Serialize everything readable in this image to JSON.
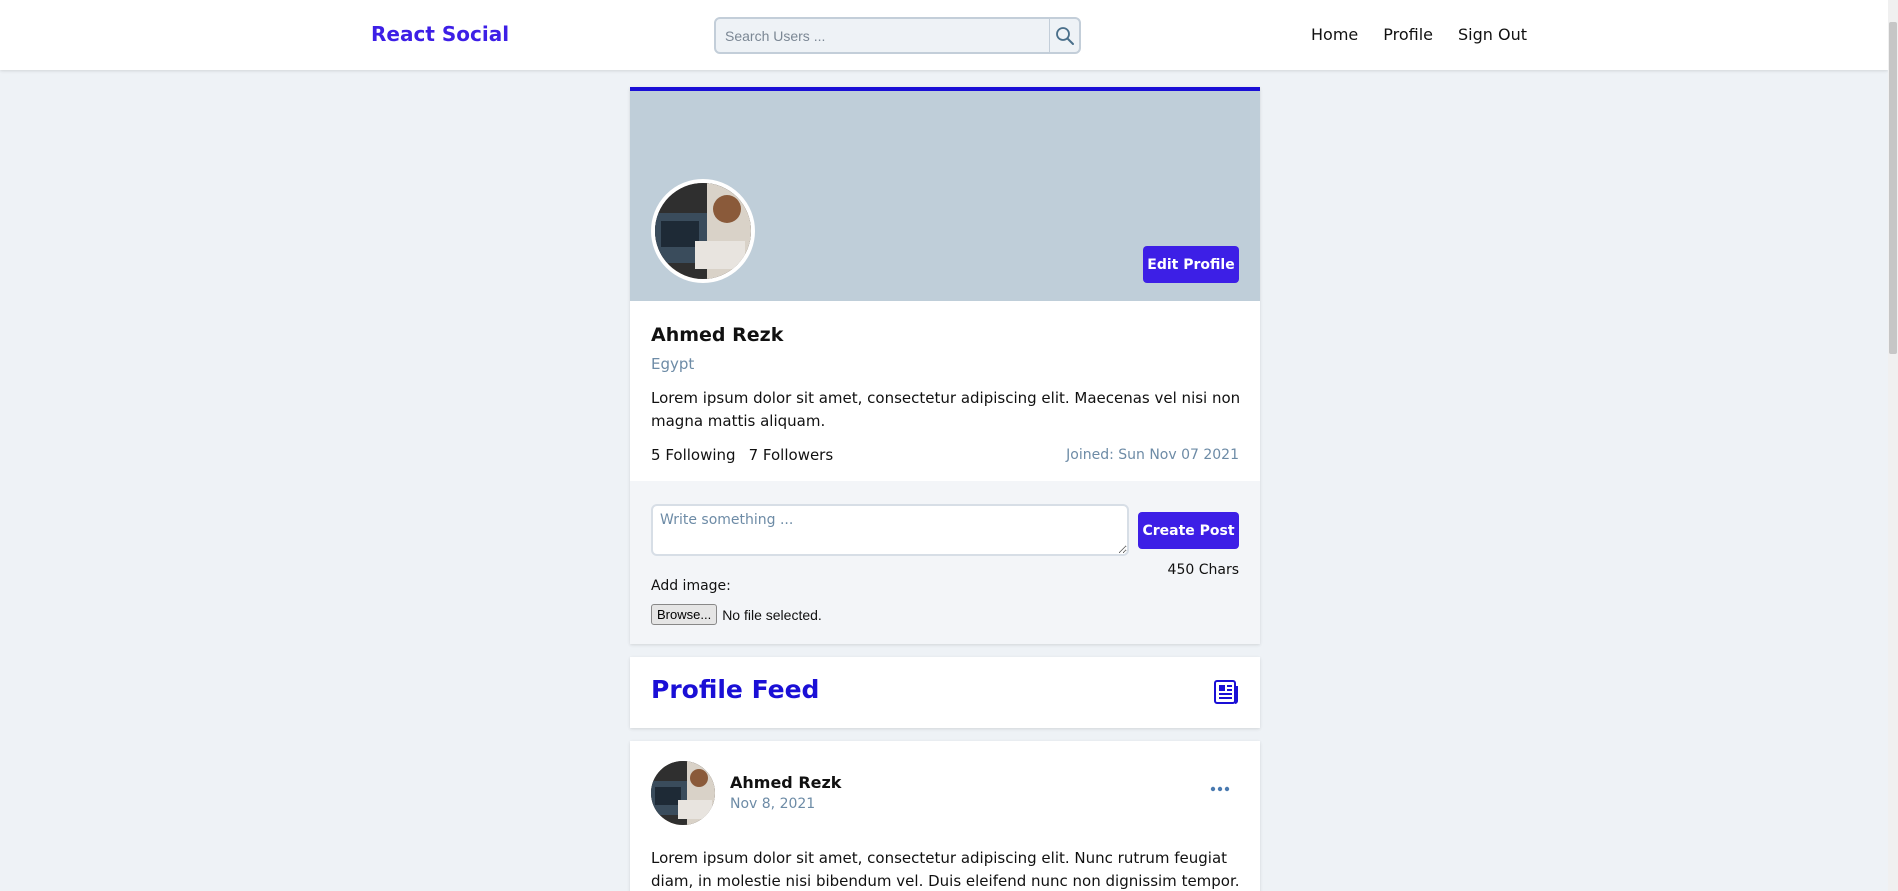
{
  "navbar": {
    "brand": "React Social",
    "search_placeholder": "Search Users ...",
    "links": [
      "Home",
      "Profile",
      "Sign Out"
    ]
  },
  "profile": {
    "name": "Ahmed Rezk",
    "location": "Egypt",
    "bio": "Lorem ipsum dolor sit amet, consectetur adipiscing elit. Maecenas vel nisi non magna mattis aliquam.",
    "following_count": "5",
    "following_label": "Following",
    "followers_count": "7",
    "followers_label": "Followers",
    "joined": "Joined: Sun Nov 07 2021",
    "edit_button": "Edit Profile"
  },
  "post_form": {
    "placeholder": "Write something ...",
    "create_button": "Create Post",
    "char_count": "450 Chars",
    "add_image_label": "Add image:",
    "browse_label": "Browse...",
    "file_status": "No file selected."
  },
  "feed": {
    "title": "Profile Feed"
  },
  "posts": [
    {
      "author": "Ahmed Rezk",
      "date": "Nov 8, 2021",
      "body": "Lorem ipsum dolor sit amet, consectetur adipiscing elit. Nunc rutrum feugiat diam, in molestie nisi bibendum vel. Duis eleifend nunc non dignissim tempor."
    }
  ],
  "colors": {
    "accent": "#3d1fe6",
    "accent_dark": "#1a0fd6",
    "muted": "#6d8ba6",
    "cover": "#bfced9",
    "page_bg": "#eef2f6"
  },
  "icons": {
    "search": "search-icon",
    "feed": "newspaper-icon",
    "menu": "more-horizontal-icon"
  }
}
